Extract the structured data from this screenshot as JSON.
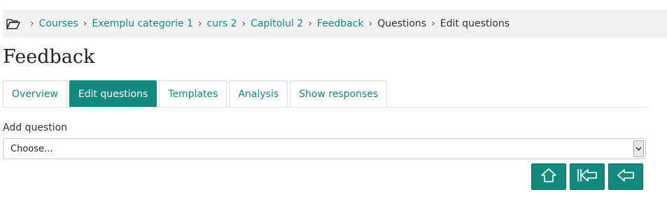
{
  "breadcrumb": {
    "items": [
      "Courses",
      "Exemplu categorie 1",
      "curs 2",
      "Capitolul 2",
      "Feedback",
      "Questions",
      "Edit questions"
    ]
  },
  "page": {
    "title": "Feedback"
  },
  "tabs": [
    {
      "label": "Overview"
    },
    {
      "label": "Edit questions"
    },
    {
      "label": "Templates"
    },
    {
      "label": "Analysis"
    },
    {
      "label": "Show responses"
    }
  ],
  "add_question": {
    "label": "Add question",
    "selected": "Choose..."
  },
  "nav_buttons": [
    {
      "icon": "home-icon"
    },
    {
      "icon": "first-page-icon"
    },
    {
      "icon": "back-arrow-icon"
    }
  ],
  "colors": {
    "accent": "#148a7e",
    "breadcrumb_bg": "#f2f2f2"
  }
}
